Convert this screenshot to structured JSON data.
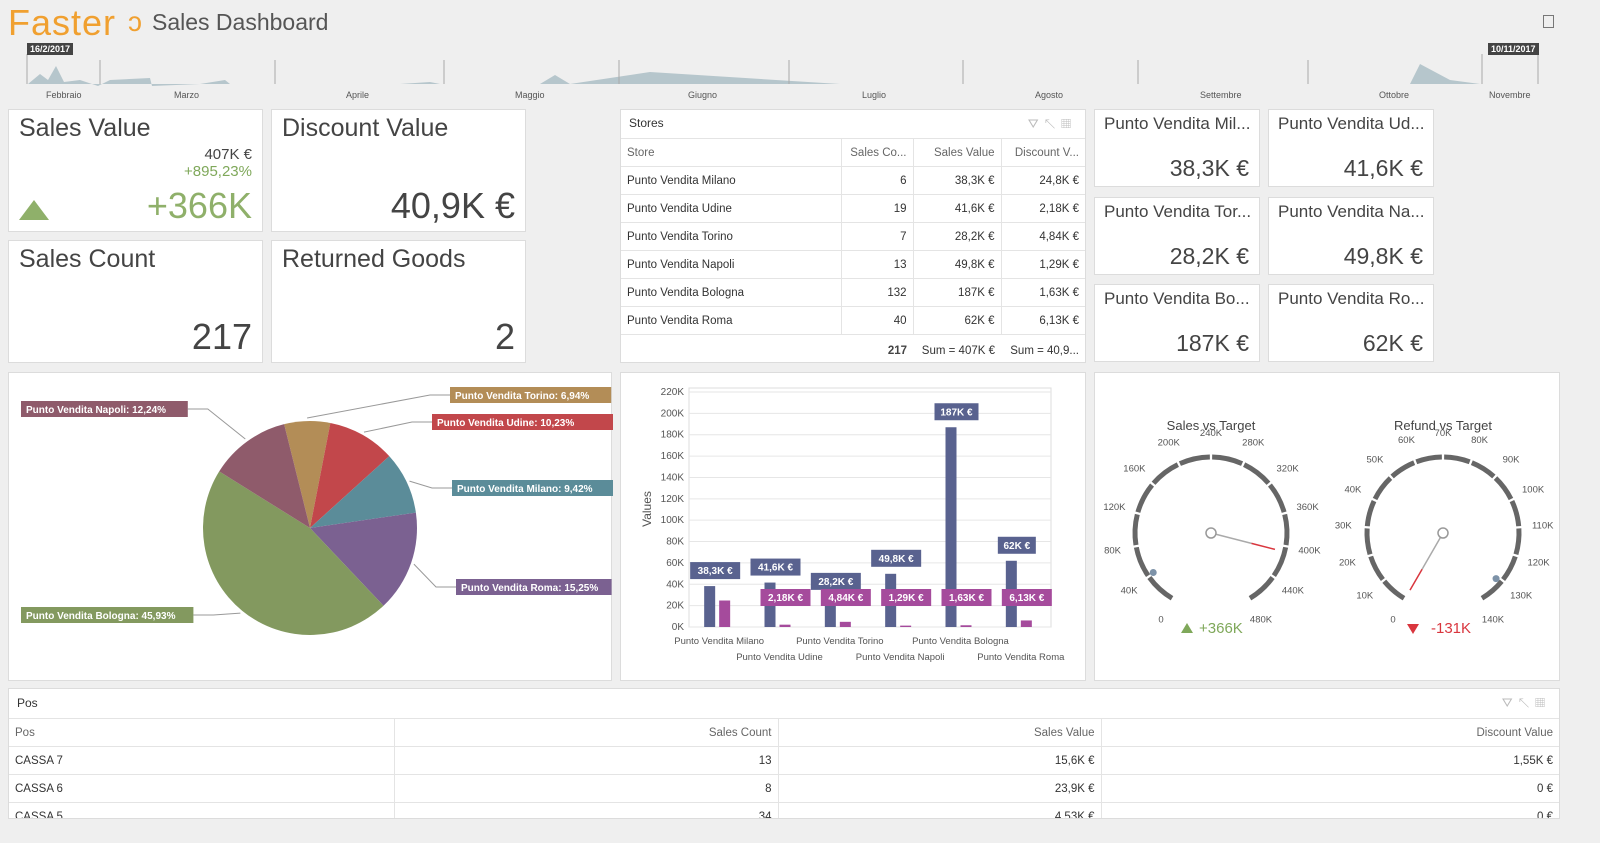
{
  "header": {
    "logo": "Faster",
    "title": "Sales Dashboard",
    "export_icon": "document-icon"
  },
  "timeline": {
    "start_date": "16/2/2017",
    "end_date": "10/11/2017",
    "months": [
      "Febbraio",
      "Marzo",
      "Aprile",
      "Maggio",
      "Giugno",
      "Luglio",
      "Agosto",
      "Settembre",
      "Ottobre",
      "Novembre"
    ]
  },
  "kpis": {
    "sales_value": {
      "title": "Sales Value",
      "total": "407K €",
      "pct": "+895,23%",
      "delta": "+366K",
      "trend": "up"
    },
    "discount_value": {
      "title": "Discount Value",
      "value": "40,9K €"
    },
    "sales_count": {
      "title": "Sales Count",
      "value": "217"
    },
    "returned_goods": {
      "title": "Returned Goods",
      "value": "2"
    }
  },
  "stores": {
    "title": "Stores",
    "columns": [
      "Store",
      "Sales Co...",
      "Sales Value",
      "Discount V..."
    ],
    "rows": [
      [
        "Punto Vendita Milano",
        "6",
        "38,3K €",
        "24,8K €"
      ],
      [
        "Punto Vendita Udine",
        "19",
        "41,6K €",
        "2,18K €"
      ],
      [
        "Punto Vendita Torino",
        "7",
        "28,2K €",
        "4,84K €"
      ],
      [
        "Punto Vendita Napoli",
        "13",
        "49,8K €",
        "1,29K €"
      ],
      [
        "Punto Vendita Bologna",
        "132",
        "187K €",
        "1,63K €"
      ],
      [
        "Punto Vendita Roma",
        "40",
        "62K €",
        "6,13K €"
      ]
    ],
    "footer": [
      "",
      "217",
      "Sum = 407K €",
      "Sum = 40,9..."
    ]
  },
  "tiles": [
    {
      "title": "Punto Vendita Mil...",
      "value": "38,3K €"
    },
    {
      "title": "Punto Vendita Ud...",
      "value": "41,6K €"
    },
    {
      "title": "Punto Vendita Tor...",
      "value": "28,2K €"
    },
    {
      "title": "Punto Vendita Na...",
      "value": "49,8K €"
    },
    {
      "title": "Punto Vendita Bo...",
      "value": "187K €"
    },
    {
      "title": "Punto Vendita Ro...",
      "value": "62K €"
    }
  ],
  "chart_data": [
    {
      "type": "pie",
      "slices": [
        {
          "label": "Punto Vendita Torino: 6,94%",
          "value": 6.94,
          "color": "#b38d57"
        },
        {
          "label": "Punto Vendita Udine:     10,23%",
          "value": 10.23,
          "color": "#c2474b"
        },
        {
          "label": "Punto Vendita Milano: 9,42%",
          "value": 9.42,
          "color": "#5b8c99"
        },
        {
          "label": "Punto Vendita Roma: 15,25%",
          "value": 15.25,
          "color": "#7b6191"
        },
        {
          "label": "Punto Vendita Bologna: 45,93%",
          "value": 45.93,
          "color": "#83995f"
        },
        {
          "label": "Punto Vendita Napoli: 12,24%",
          "value": 12.24,
          "color": "#8f5b6b"
        }
      ]
    },
    {
      "type": "bar",
      "ylabel": "Values",
      "ylim": [
        0,
        220000
      ],
      "yticks": [
        "0K",
        "20K",
        "40K",
        "60K",
        "80K",
        "100K",
        "120K",
        "140K",
        "160K",
        "180K",
        "200K",
        "220K"
      ],
      "categories": [
        "Punto Vendita  Milano",
        "Punto Vendita  Udine",
        "Punto Vendita  Torino",
        "Punto Vendita  Napoli",
        "Punto Vendita  Bologna",
        "Punto Vendita  Roma"
      ],
      "series": [
        {
          "values": [
            38300,
            41600,
            28200,
            49800,
            187000,
            62000
          ],
          "labels": [
            "38,3K €",
            "41,6K €",
            "28,2K €",
            "49,8K €",
            "187K €",
            "62K €"
          ],
          "color": "#59628f"
        },
        {
          "values": [
            24800,
            2180,
            4840,
            1290,
            1630,
            6130
          ],
          "labels": [
            null,
            "2,18K €",
            "4,84K €",
            "1,29K €",
            "1,63K €",
            "6,13K €"
          ],
          "color": "#a54b9c"
        }
      ]
    },
    {
      "type": "gauge",
      "title": "Sales vs Target",
      "min": 0,
      "max": 480000,
      "value": 407000,
      "target": 41000,
      "ticks": [
        "0",
        "40K",
        "80K",
        "120K",
        "160K",
        "200K",
        "240K",
        "280K",
        "320K",
        "360K",
        "400K",
        "440K",
        "480K"
      ],
      "delta": "+366K",
      "trend": "up",
      "delta_color": "#7fa85a"
    },
    {
      "type": "gauge",
      "title": "Refund vs Target",
      "min": 0,
      "max": 140000,
      "value": 0,
      "target": 131000,
      "ticks": [
        "0",
        "10K",
        "20K",
        "30K",
        "40K",
        "50K",
        "60K",
        "70K",
        "80K",
        "90K",
        "100K",
        "110K",
        "120K",
        "130K",
        "140K"
      ],
      "delta": "-131K",
      "trend": "down",
      "delta_color": "#d9363e"
    }
  ],
  "pos": {
    "title": "Pos",
    "columns": [
      "Pos",
      "Sales Count",
      "Sales Value",
      "Discount Value"
    ],
    "rows": [
      [
        "CASSA 7",
        "13",
        "15,6K €",
        "1,55K €"
      ],
      [
        "CASSA 6",
        "8",
        "23,9K €",
        "0 €"
      ],
      [
        "CASSA 5",
        "34",
        "4,53K €",
        "0 €"
      ]
    ]
  },
  "colors": {
    "accent": "#f0a030",
    "positive": "#7fa85a",
    "negative": "#d9363e"
  }
}
